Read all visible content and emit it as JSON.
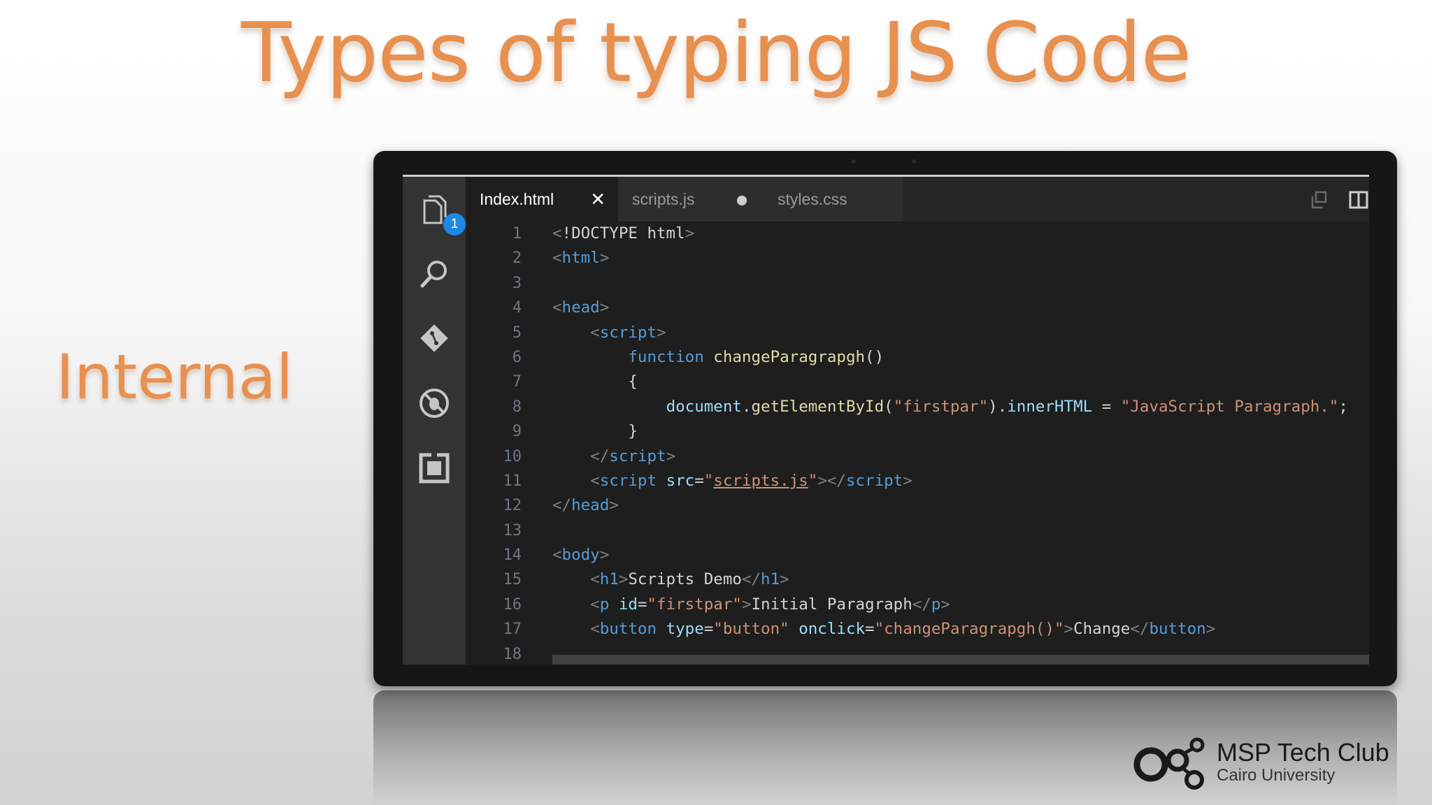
{
  "slide": {
    "title": "Types of typing JS Code",
    "side_label": "Internal"
  },
  "colors": {
    "title": "#e8904f",
    "editor_bg": "#1e1e1e",
    "activity_bar": "#333333",
    "badge": "#1e88e5"
  },
  "activity_bar": {
    "items": [
      {
        "icon": "files-icon",
        "badge": "1"
      },
      {
        "icon": "search-icon"
      },
      {
        "icon": "git-icon"
      },
      {
        "icon": "debug-icon"
      },
      {
        "icon": "extensions-icon"
      }
    ]
  },
  "tabs": [
    {
      "label": "Index.html",
      "active": true,
      "close": "✕"
    },
    {
      "label": "scripts.js",
      "active": false,
      "modified": true
    },
    {
      "label": "styles.css",
      "active": false
    }
  ],
  "toolbar_icons": [
    "open-changes-icon",
    "split-editor-icon"
  ],
  "editor": {
    "line_numbers": [
      "1",
      "2",
      "3",
      "4",
      "5",
      "6",
      "7",
      "8",
      "9",
      "10",
      "11",
      "12",
      "13",
      "14",
      "15",
      "16",
      "17",
      "18"
    ]
  },
  "code": {
    "l1": {
      "open": "<",
      "doctype": "!DOCTYPE html",
      "close": ">"
    },
    "l2": {
      "open": "<",
      "tag": "html",
      "close": ">"
    },
    "l4": {
      "open": "<",
      "tag": "head",
      "close": ">"
    },
    "l5": {
      "indent": "    ",
      "open": "<",
      "tag": "script",
      "close": ">"
    },
    "l6": {
      "indent": "        ",
      "keyword": "function",
      "sp": " ",
      "name": "changeParagrapgh",
      "rest": "()"
    },
    "l7": {
      "text": "        {"
    },
    "l8": {
      "indent": "            ",
      "obj": "document",
      "dot": ".",
      "method": "getElementById",
      "p1": "(",
      "arg": "\"firstpar\"",
      "p2": ").",
      "prop": "innerHTML",
      "eq": " = ",
      "str": "\"JavaScript Paragraph.\"",
      "semi": ";"
    },
    "l9": {
      "text": "        }"
    },
    "l10": {
      "indent": "    ",
      "open": "</",
      "tag": "script",
      "close": ">"
    },
    "l11": {
      "indent": "    ",
      "open": "<",
      "tag": "script",
      "sp": " ",
      "attr": "src",
      "eq": "=",
      "q1": "\"",
      "val": "scripts.js",
      "q2": "\"",
      "close1": "></",
      "tag2": "script",
      "close2": ">"
    },
    "l12": {
      "open": "</",
      "tag": "head",
      "close": ">"
    },
    "l14": {
      "open": "<",
      "tag": "body",
      "close": ">"
    },
    "l15": {
      "indent": "    ",
      "open": "<",
      "tag": "h1",
      "close": ">",
      "text": "Scripts Demo",
      "open2": "</",
      "tag2": "h1",
      "close2": ">"
    },
    "l16": {
      "indent": "    ",
      "open": "<",
      "tag": "p",
      "sp": " ",
      "attr": "id",
      "eq": "=",
      "val": "\"firstpar\"",
      "close": ">",
      "text": "Initial Paragraph",
      "open2": "</",
      "tag2": "p",
      "close2": ">"
    },
    "l17": {
      "indent": "    ",
      "open": "<",
      "tag": "button",
      "sp": " ",
      "attr": "type",
      "eq": "=",
      "val": "\"button\"",
      "sp2": " ",
      "attr2": "onclick",
      "eq2": "=",
      "val2": "\"changeParagrapgh()\"",
      "close": ">",
      "text": "Change",
      "open2": "</",
      "tag2": "button",
      "close2": ">"
    }
  },
  "logo": {
    "name": "MSP Tech Club",
    "subtitle": "Cairo University"
  }
}
